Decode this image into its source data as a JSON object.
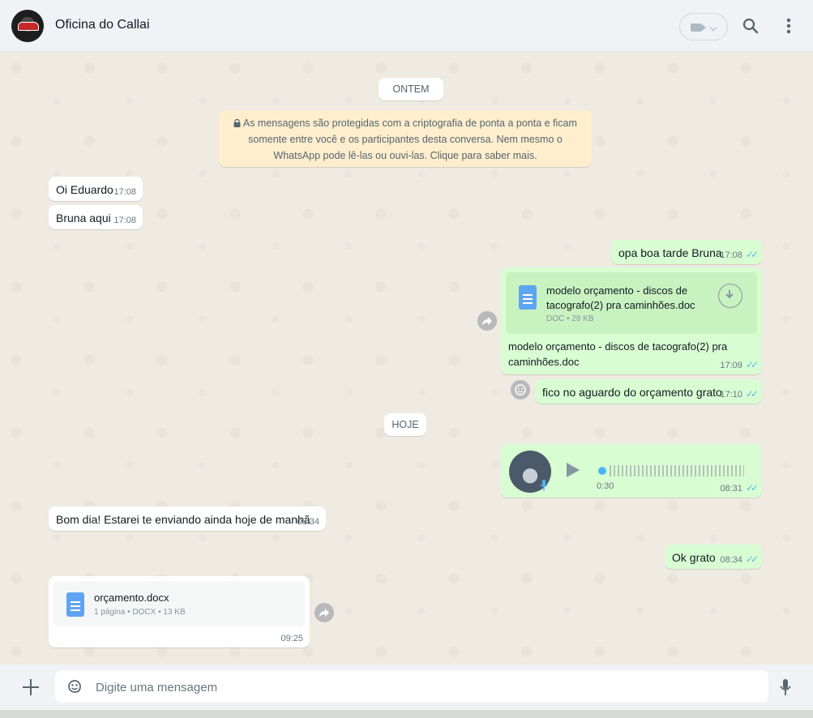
{
  "header": {
    "contact_name": "Oficina do Callai"
  },
  "chat": {
    "day_yesterday": "ONTEM",
    "day_today": "HOJE",
    "encryption_notice": {
      "line1": "As mensagens são protegidas com a criptografia de ponta a ponta e ficam",
      "line2": "somente entre você e os participantes desta conversa. Nem mesmo o",
      "line3": "WhatsApp pode lê-las ou ouvi-las. Clique para saber mais."
    },
    "messages": [
      {
        "text": "Oi Eduardo",
        "time": "17:08"
      },
      {
        "text": "Bruna aqui",
        "time": "17:08"
      },
      {
        "text": "opa boa tarde Bruna",
        "time": "17:08"
      },
      {
        "file_name_line1": "modelo orçamento - discos de",
        "file_name_line2": "tacografo(2) pra caminhões.doc",
        "file_meta": "DOC • 28 KB",
        "caption_line1": "modelo orçamento - discos de tacografo(2) pra",
        "caption_line2": "caminhões.doc",
        "time": "17:09"
      },
      {
        "text": "fico no aguardo do orçamento grato",
        "time": "17:10"
      },
      {
        "audio_duration": "0:30",
        "time": "08:31",
        "audio_progress": 0
      },
      {
        "text": "Bom dia! Estarei te enviando ainda hoje de manhã",
        "time": "08:34"
      },
      {
        "text": "Ok grato",
        "time": "08:34"
      },
      {
        "file_name": "orçamento.docx",
        "file_meta": "1 página • DOCX • 13 KB",
        "time": "09:25"
      }
    ]
  },
  "composer": {
    "placeholder": "Digite uma mensagem"
  },
  "colors": {
    "chat_background": "#efeae2",
    "incoming_bubble": "#ffffff",
    "outgoing_bubble": "#d9fdd3",
    "read_ticks": "#53bdeb",
    "encryption_banner": "#ffeecd"
  }
}
